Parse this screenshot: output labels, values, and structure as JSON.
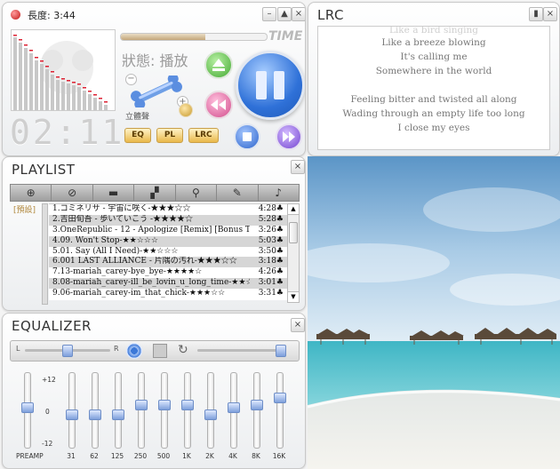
{
  "player": {
    "length_label": "長度: 3:44",
    "status_label": "狀態: 播放",
    "time_logo": "TIME",
    "surround_label": "立體聲",
    "time_display": "02:11",
    "buttons": {
      "eq": "EQ",
      "pl": "PL",
      "lrc": "LRC"
    },
    "window_buttons": [
      "–",
      "▲",
      "×"
    ]
  },
  "lrc": {
    "title": "LRC",
    "lines": [
      "Like a bird singing",
      "Like a breeze blowing",
      "It's calling me",
      "Somewhere in the world",
      "",
      "Feeling bitter and twisted all along",
      "Wading through an empty life too long",
      "I close my eyes"
    ]
  },
  "playlist": {
    "title": "PLAYLIST",
    "category": "[預設]",
    "items": [
      {
        "name": "1.コミネリサ - 宇宙に咲く-★★★☆☆",
        "time": "4:28"
      },
      {
        "name": "2.吉田旬吾 - 歩いていこう -★★★★☆",
        "time": "5:28"
      },
      {
        "name": "3.OneRepublic - 12 - Apologize [Remix] [Bonus T...",
        "time": "3:26"
      },
      {
        "name": "4.09. Won't Stop-★★☆☆☆",
        "time": "5:03"
      },
      {
        "name": "5.01. Say (All I Need)-★★☆☆☆",
        "time": "3:50"
      },
      {
        "name": "6.001 LAST ALLIANCE - 片隅の汚れ-★★★☆☆",
        "time": "3:18"
      },
      {
        "name": "7.13-mariah_carey-bye_bye-★★★★☆",
        "time": "4:26"
      },
      {
        "name": "8.08-mariah_carey-ill_be_lovin_u_long_time-★★☆☆☆",
        "time": "3:01"
      },
      {
        "name": "9.06-mariah_carey-im_that_chick-★★★☆☆",
        "time": "3:31"
      }
    ],
    "time_suffix": "♣"
  },
  "equalizer": {
    "title": "EQUALIZER",
    "balance_left": "L",
    "balance_right": "R",
    "scale": [
      "+12",
      "0",
      "-12"
    ],
    "bands": [
      {
        "label": "PREAMP",
        "level": 0.55
      },
      {
        "label": "31",
        "level": 0.45
      },
      {
        "label": "62",
        "level": 0.45
      },
      {
        "label": "125",
        "level": 0.45
      },
      {
        "label": "250",
        "level": 0.6
      },
      {
        "label": "500",
        "level": 0.6
      },
      {
        "label": "1K",
        "level": 0.6
      },
      {
        "label": "2K",
        "level": 0.45
      },
      {
        "label": "4K",
        "level": 0.55
      },
      {
        "label": "8K",
        "level": 0.6
      },
      {
        "label": "16K",
        "level": 0.7
      }
    ]
  },
  "colors": {
    "accent_blue": "#3b7fe0",
    "green": "#5dc24a",
    "pink": "#e05aa0",
    "purple": "#7a4fd6"
  }
}
